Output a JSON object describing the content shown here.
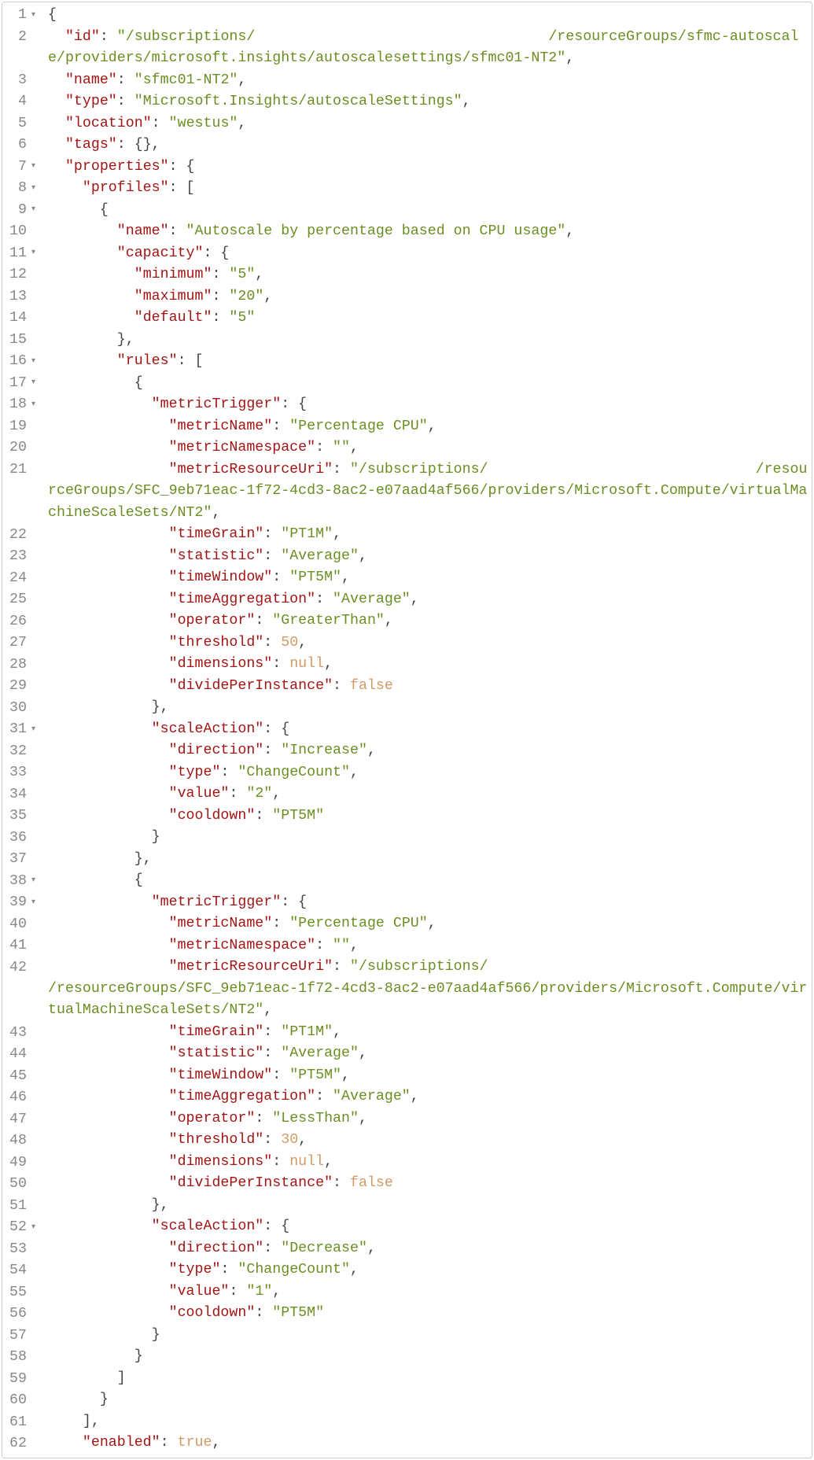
{
  "lines": [
    {
      "num": "1",
      "fold": true,
      "indent": 0,
      "wrap": false,
      "segs": [
        {
          "c": "p",
          "t": "{"
        }
      ]
    },
    {
      "num": "2",
      "fold": false,
      "indent": 1,
      "wrap": true,
      "segs": [
        {
          "c": "k",
          "t": "\"id\""
        },
        {
          "c": "p",
          "t": ": "
        },
        {
          "c": "s",
          "t": "\"/subscriptions/                                  /resourceGroups/sfmc-autoscale/providers/microsoft.insights/autoscalesettings/sfmc01-NT2\""
        },
        {
          "c": "p",
          "t": ","
        }
      ]
    },
    {
      "num": "3",
      "fold": false,
      "indent": 1,
      "wrap": false,
      "segs": [
        {
          "c": "k",
          "t": "\"name\""
        },
        {
          "c": "p",
          "t": ": "
        },
        {
          "c": "s",
          "t": "\"sfmc01-NT2\""
        },
        {
          "c": "p",
          "t": ","
        }
      ]
    },
    {
      "num": "4",
      "fold": false,
      "indent": 1,
      "wrap": false,
      "segs": [
        {
          "c": "k",
          "t": "\"type\""
        },
        {
          "c": "p",
          "t": ": "
        },
        {
          "c": "s",
          "t": "\"Microsoft.Insights/autoscaleSettings\""
        },
        {
          "c": "p",
          "t": ","
        }
      ]
    },
    {
      "num": "5",
      "fold": false,
      "indent": 1,
      "wrap": false,
      "segs": [
        {
          "c": "k",
          "t": "\"location\""
        },
        {
          "c": "p",
          "t": ": "
        },
        {
          "c": "s",
          "t": "\"westus\""
        },
        {
          "c": "p",
          "t": ","
        }
      ]
    },
    {
      "num": "6",
      "fold": false,
      "indent": 1,
      "wrap": false,
      "segs": [
        {
          "c": "k",
          "t": "\"tags\""
        },
        {
          "c": "p",
          "t": ": {},"
        }
      ]
    },
    {
      "num": "7",
      "fold": true,
      "indent": 1,
      "wrap": false,
      "segs": [
        {
          "c": "k",
          "t": "\"properties\""
        },
        {
          "c": "p",
          "t": ": {"
        }
      ]
    },
    {
      "num": "8",
      "fold": true,
      "indent": 2,
      "wrap": false,
      "segs": [
        {
          "c": "k",
          "t": "\"profiles\""
        },
        {
          "c": "p",
          "t": ": ["
        }
      ]
    },
    {
      "num": "9",
      "fold": true,
      "indent": 3,
      "wrap": false,
      "segs": [
        {
          "c": "p",
          "t": "{"
        }
      ]
    },
    {
      "num": "10",
      "fold": false,
      "indent": 4,
      "wrap": false,
      "segs": [
        {
          "c": "k",
          "t": "\"name\""
        },
        {
          "c": "p",
          "t": ": "
        },
        {
          "c": "s",
          "t": "\"Autoscale by percentage based on CPU usage\""
        },
        {
          "c": "p",
          "t": ","
        }
      ]
    },
    {
      "num": "11",
      "fold": true,
      "indent": 4,
      "wrap": false,
      "segs": [
        {
          "c": "k",
          "t": "\"capacity\""
        },
        {
          "c": "p",
          "t": ": {"
        }
      ]
    },
    {
      "num": "12",
      "fold": false,
      "indent": 5,
      "wrap": false,
      "segs": [
        {
          "c": "k",
          "t": "\"minimum\""
        },
        {
          "c": "p",
          "t": ": "
        },
        {
          "c": "s",
          "t": "\"5\""
        },
        {
          "c": "p",
          "t": ","
        }
      ]
    },
    {
      "num": "13",
      "fold": false,
      "indent": 5,
      "wrap": false,
      "segs": [
        {
          "c": "k",
          "t": "\"maximum\""
        },
        {
          "c": "p",
          "t": ": "
        },
        {
          "c": "s",
          "t": "\"20\""
        },
        {
          "c": "p",
          "t": ","
        }
      ]
    },
    {
      "num": "14",
      "fold": false,
      "indent": 5,
      "wrap": false,
      "segs": [
        {
          "c": "k",
          "t": "\"default\""
        },
        {
          "c": "p",
          "t": ": "
        },
        {
          "c": "s",
          "t": "\"5\""
        }
      ]
    },
    {
      "num": "15",
      "fold": false,
      "indent": 4,
      "wrap": false,
      "segs": [
        {
          "c": "p",
          "t": "},"
        }
      ]
    },
    {
      "num": "16",
      "fold": true,
      "indent": 4,
      "wrap": false,
      "segs": [
        {
          "c": "k",
          "t": "\"rules\""
        },
        {
          "c": "p",
          "t": ": ["
        }
      ]
    },
    {
      "num": "17",
      "fold": true,
      "indent": 5,
      "wrap": false,
      "segs": [
        {
          "c": "p",
          "t": "{"
        }
      ]
    },
    {
      "num": "18",
      "fold": true,
      "indent": 6,
      "wrap": false,
      "segs": [
        {
          "c": "k",
          "t": "\"metricTrigger\""
        },
        {
          "c": "p",
          "t": ": {"
        }
      ]
    },
    {
      "num": "19",
      "fold": false,
      "indent": 7,
      "wrap": false,
      "segs": [
        {
          "c": "k",
          "t": "\"metricName\""
        },
        {
          "c": "p",
          "t": ": "
        },
        {
          "c": "s",
          "t": "\"Percentage CPU\""
        },
        {
          "c": "p",
          "t": ","
        }
      ]
    },
    {
      "num": "20",
      "fold": false,
      "indent": 7,
      "wrap": false,
      "segs": [
        {
          "c": "k",
          "t": "\"metricNamespace\""
        },
        {
          "c": "p",
          "t": ": "
        },
        {
          "c": "s",
          "t": "\"\""
        },
        {
          "c": "p",
          "t": ","
        }
      ]
    },
    {
      "num": "21",
      "fold": false,
      "indent": 7,
      "wrap": true,
      "segs": [
        {
          "c": "k",
          "t": "\"metricResourceUri\""
        },
        {
          "c": "p",
          "t": ": "
        },
        {
          "c": "s",
          "t": "\"/subscriptions/                               /resourceGroups/SFC_9eb71eac-1f72-4cd3-8ac2-e07aad4af566/providers/Microsoft.Compute/virtualMachineScaleSets/NT2\""
        },
        {
          "c": "p",
          "t": ","
        }
      ]
    },
    {
      "num": "22",
      "fold": false,
      "indent": 7,
      "wrap": false,
      "segs": [
        {
          "c": "k",
          "t": "\"timeGrain\""
        },
        {
          "c": "p",
          "t": ": "
        },
        {
          "c": "s",
          "t": "\"PT1M\""
        },
        {
          "c": "p",
          "t": ","
        }
      ]
    },
    {
      "num": "23",
      "fold": false,
      "indent": 7,
      "wrap": false,
      "segs": [
        {
          "c": "k",
          "t": "\"statistic\""
        },
        {
          "c": "p",
          "t": ": "
        },
        {
          "c": "s",
          "t": "\"Average\""
        },
        {
          "c": "p",
          "t": ","
        }
      ]
    },
    {
      "num": "24",
      "fold": false,
      "indent": 7,
      "wrap": false,
      "segs": [
        {
          "c": "k",
          "t": "\"timeWindow\""
        },
        {
          "c": "p",
          "t": ": "
        },
        {
          "c": "s",
          "t": "\"PT5M\""
        },
        {
          "c": "p",
          "t": ","
        }
      ]
    },
    {
      "num": "25",
      "fold": false,
      "indent": 7,
      "wrap": false,
      "segs": [
        {
          "c": "k",
          "t": "\"timeAggregation\""
        },
        {
          "c": "p",
          "t": ": "
        },
        {
          "c": "s",
          "t": "\"Average\""
        },
        {
          "c": "p",
          "t": ","
        }
      ]
    },
    {
      "num": "26",
      "fold": false,
      "indent": 7,
      "wrap": false,
      "segs": [
        {
          "c": "k",
          "t": "\"operator\""
        },
        {
          "c": "p",
          "t": ": "
        },
        {
          "c": "s",
          "t": "\"GreaterThan\""
        },
        {
          "c": "p",
          "t": ","
        }
      ]
    },
    {
      "num": "27",
      "fold": false,
      "indent": 7,
      "wrap": false,
      "segs": [
        {
          "c": "k",
          "t": "\"threshold\""
        },
        {
          "c": "p",
          "t": ": "
        },
        {
          "c": "n",
          "t": "50"
        },
        {
          "c": "p",
          "t": ","
        }
      ]
    },
    {
      "num": "28",
      "fold": false,
      "indent": 7,
      "wrap": false,
      "segs": [
        {
          "c": "k",
          "t": "\"dimensions\""
        },
        {
          "c": "p",
          "t": ": "
        },
        {
          "c": "b",
          "t": "null"
        },
        {
          "c": "p",
          "t": ","
        }
      ]
    },
    {
      "num": "29",
      "fold": false,
      "indent": 7,
      "wrap": false,
      "segs": [
        {
          "c": "k",
          "t": "\"dividePerInstance\""
        },
        {
          "c": "p",
          "t": ": "
        },
        {
          "c": "b",
          "t": "false"
        }
      ]
    },
    {
      "num": "30",
      "fold": false,
      "indent": 6,
      "wrap": false,
      "segs": [
        {
          "c": "p",
          "t": "},"
        }
      ]
    },
    {
      "num": "31",
      "fold": true,
      "indent": 6,
      "wrap": false,
      "segs": [
        {
          "c": "k",
          "t": "\"scaleAction\""
        },
        {
          "c": "p",
          "t": ": {"
        }
      ]
    },
    {
      "num": "32",
      "fold": false,
      "indent": 7,
      "wrap": false,
      "segs": [
        {
          "c": "k",
          "t": "\"direction\""
        },
        {
          "c": "p",
          "t": ": "
        },
        {
          "c": "s",
          "t": "\"Increase\""
        },
        {
          "c": "p",
          "t": ","
        }
      ]
    },
    {
      "num": "33",
      "fold": false,
      "indent": 7,
      "wrap": false,
      "segs": [
        {
          "c": "k",
          "t": "\"type\""
        },
        {
          "c": "p",
          "t": ": "
        },
        {
          "c": "s",
          "t": "\"ChangeCount\""
        },
        {
          "c": "p",
          "t": ","
        }
      ]
    },
    {
      "num": "34",
      "fold": false,
      "indent": 7,
      "wrap": false,
      "segs": [
        {
          "c": "k",
          "t": "\"value\""
        },
        {
          "c": "p",
          "t": ": "
        },
        {
          "c": "s",
          "t": "\"2\""
        },
        {
          "c": "p",
          "t": ","
        }
      ]
    },
    {
      "num": "35",
      "fold": false,
      "indent": 7,
      "wrap": false,
      "segs": [
        {
          "c": "k",
          "t": "\"cooldown\""
        },
        {
          "c": "p",
          "t": ": "
        },
        {
          "c": "s",
          "t": "\"PT5M\""
        }
      ]
    },
    {
      "num": "36",
      "fold": false,
      "indent": 6,
      "wrap": false,
      "segs": [
        {
          "c": "p",
          "t": "}"
        }
      ]
    },
    {
      "num": "37",
      "fold": false,
      "indent": 5,
      "wrap": false,
      "segs": [
        {
          "c": "p",
          "t": "},"
        }
      ]
    },
    {
      "num": "38",
      "fold": true,
      "indent": 5,
      "wrap": false,
      "segs": [
        {
          "c": "p",
          "t": "{"
        }
      ]
    },
    {
      "num": "39",
      "fold": true,
      "indent": 6,
      "wrap": false,
      "segs": [
        {
          "c": "k",
          "t": "\"metricTrigger\""
        },
        {
          "c": "p",
          "t": ": {"
        }
      ]
    },
    {
      "num": "40",
      "fold": false,
      "indent": 7,
      "wrap": false,
      "segs": [
        {
          "c": "k",
          "t": "\"metricName\""
        },
        {
          "c": "p",
          "t": ": "
        },
        {
          "c": "s",
          "t": "\"Percentage CPU\""
        },
        {
          "c": "p",
          "t": ","
        }
      ]
    },
    {
      "num": "41",
      "fold": false,
      "indent": 7,
      "wrap": false,
      "segs": [
        {
          "c": "k",
          "t": "\"metricNamespace\""
        },
        {
          "c": "p",
          "t": ": "
        },
        {
          "c": "s",
          "t": "\"\""
        },
        {
          "c": "p",
          "t": ","
        }
      ]
    },
    {
      "num": "42",
      "fold": false,
      "indent": 7,
      "wrap": true,
      "segs": [
        {
          "c": "k",
          "t": "\"metricResourceUri\""
        },
        {
          "c": "p",
          "t": ": "
        },
        {
          "c": "s",
          "t": "\"/subscriptions/                                      /resourceGroups/SFC_9eb71eac-1f72-4cd3-8ac2-e07aad4af566/providers/Microsoft.Compute/virtualMachineScaleSets/NT2\""
        },
        {
          "c": "p",
          "t": ","
        }
      ]
    },
    {
      "num": "43",
      "fold": false,
      "indent": 7,
      "wrap": false,
      "segs": [
        {
          "c": "k",
          "t": "\"timeGrain\""
        },
        {
          "c": "p",
          "t": ": "
        },
        {
          "c": "s",
          "t": "\"PT1M\""
        },
        {
          "c": "p",
          "t": ","
        }
      ]
    },
    {
      "num": "44",
      "fold": false,
      "indent": 7,
      "wrap": false,
      "segs": [
        {
          "c": "k",
          "t": "\"statistic\""
        },
        {
          "c": "p",
          "t": ": "
        },
        {
          "c": "s",
          "t": "\"Average\""
        },
        {
          "c": "p",
          "t": ","
        }
      ]
    },
    {
      "num": "45",
      "fold": false,
      "indent": 7,
      "wrap": false,
      "segs": [
        {
          "c": "k",
          "t": "\"timeWindow\""
        },
        {
          "c": "p",
          "t": ": "
        },
        {
          "c": "s",
          "t": "\"PT5M\""
        },
        {
          "c": "p",
          "t": ","
        }
      ]
    },
    {
      "num": "46",
      "fold": false,
      "indent": 7,
      "wrap": false,
      "segs": [
        {
          "c": "k",
          "t": "\"timeAggregation\""
        },
        {
          "c": "p",
          "t": ": "
        },
        {
          "c": "s",
          "t": "\"Average\""
        },
        {
          "c": "p",
          "t": ","
        }
      ]
    },
    {
      "num": "47",
      "fold": false,
      "indent": 7,
      "wrap": false,
      "segs": [
        {
          "c": "k",
          "t": "\"operator\""
        },
        {
          "c": "p",
          "t": ": "
        },
        {
          "c": "s",
          "t": "\"LessThan\""
        },
        {
          "c": "p",
          "t": ","
        }
      ]
    },
    {
      "num": "48",
      "fold": false,
      "indent": 7,
      "wrap": false,
      "segs": [
        {
          "c": "k",
          "t": "\"threshold\""
        },
        {
          "c": "p",
          "t": ": "
        },
        {
          "c": "n",
          "t": "30"
        },
        {
          "c": "p",
          "t": ","
        }
      ]
    },
    {
      "num": "49",
      "fold": false,
      "indent": 7,
      "wrap": false,
      "segs": [
        {
          "c": "k",
          "t": "\"dimensions\""
        },
        {
          "c": "p",
          "t": ": "
        },
        {
          "c": "b",
          "t": "null"
        },
        {
          "c": "p",
          "t": ","
        }
      ]
    },
    {
      "num": "50",
      "fold": false,
      "indent": 7,
      "wrap": false,
      "segs": [
        {
          "c": "k",
          "t": "\"dividePerInstance\""
        },
        {
          "c": "p",
          "t": ": "
        },
        {
          "c": "b",
          "t": "false"
        }
      ]
    },
    {
      "num": "51",
      "fold": false,
      "indent": 6,
      "wrap": false,
      "segs": [
        {
          "c": "p",
          "t": "},"
        }
      ]
    },
    {
      "num": "52",
      "fold": true,
      "indent": 6,
      "wrap": false,
      "segs": [
        {
          "c": "k",
          "t": "\"scaleAction\""
        },
        {
          "c": "p",
          "t": ": {"
        }
      ]
    },
    {
      "num": "53",
      "fold": false,
      "indent": 7,
      "wrap": false,
      "segs": [
        {
          "c": "k",
          "t": "\"direction\""
        },
        {
          "c": "p",
          "t": ": "
        },
        {
          "c": "s",
          "t": "\"Decrease\""
        },
        {
          "c": "p",
          "t": ","
        }
      ]
    },
    {
      "num": "54",
      "fold": false,
      "indent": 7,
      "wrap": false,
      "segs": [
        {
          "c": "k",
          "t": "\"type\""
        },
        {
          "c": "p",
          "t": ": "
        },
        {
          "c": "s",
          "t": "\"ChangeCount\""
        },
        {
          "c": "p",
          "t": ","
        }
      ]
    },
    {
      "num": "55",
      "fold": false,
      "indent": 7,
      "wrap": false,
      "segs": [
        {
          "c": "k",
          "t": "\"value\""
        },
        {
          "c": "p",
          "t": ": "
        },
        {
          "c": "s",
          "t": "\"1\""
        },
        {
          "c": "p",
          "t": ","
        }
      ]
    },
    {
      "num": "56",
      "fold": false,
      "indent": 7,
      "wrap": false,
      "segs": [
        {
          "c": "k",
          "t": "\"cooldown\""
        },
        {
          "c": "p",
          "t": ": "
        },
        {
          "c": "s",
          "t": "\"PT5M\""
        }
      ]
    },
    {
      "num": "57",
      "fold": false,
      "indent": 6,
      "wrap": false,
      "segs": [
        {
          "c": "p",
          "t": "}"
        }
      ]
    },
    {
      "num": "58",
      "fold": false,
      "indent": 5,
      "wrap": false,
      "segs": [
        {
          "c": "p",
          "t": "}"
        }
      ]
    },
    {
      "num": "59",
      "fold": false,
      "indent": 4,
      "wrap": false,
      "segs": [
        {
          "c": "p",
          "t": "]"
        }
      ]
    },
    {
      "num": "60",
      "fold": false,
      "indent": 3,
      "wrap": false,
      "segs": [
        {
          "c": "p",
          "t": "}"
        }
      ]
    },
    {
      "num": "61",
      "fold": false,
      "indent": 2,
      "wrap": false,
      "segs": [
        {
          "c": "p",
          "t": "],"
        }
      ]
    },
    {
      "num": "62",
      "fold": false,
      "indent": 2,
      "wrap": false,
      "segs": [
        {
          "c": "k",
          "t": "\"enabled\""
        },
        {
          "c": "p",
          "t": ": "
        },
        {
          "c": "b",
          "t": "true"
        },
        {
          "c": "p",
          "t": ","
        }
      ]
    }
  ],
  "indentUnit": "  "
}
